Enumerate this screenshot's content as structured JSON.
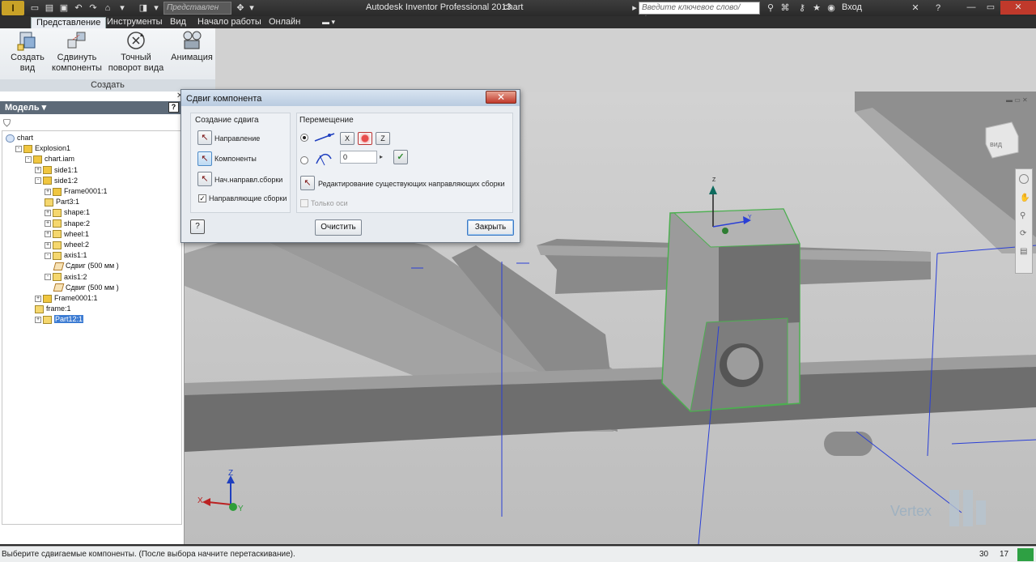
{
  "titlebar": {
    "qat_search": "Представлен",
    "app_title": "Autodesk Inventor Professional 2013",
    "doc_name": "chart",
    "help_search_placeholder": "Введите ключевое слово/фразу",
    "login": "Вход"
  },
  "ribbon": {
    "tabs": [
      "Представление",
      "Инструменты",
      "Вид",
      "Начало работы",
      "Онлайн"
    ],
    "active_tab": "Представление",
    "buttons": [
      {
        "label": "Создать вид",
        "icon": "create-view-icon"
      },
      {
        "label": "Сдвинуть компоненты",
        "icon": "tweak-components-icon"
      },
      {
        "label": "Точный поворот вида",
        "icon": "precise-rotate-icon"
      },
      {
        "label": "Анимация",
        "icon": "animation-icon"
      }
    ],
    "panel_label": "Создать"
  },
  "browser": {
    "title": "Модель ▾",
    "tree": [
      {
        "label": "chart",
        "depth": 0,
        "icon": "root"
      },
      {
        "label": "Explosion1",
        "depth": 1,
        "icon": "asm",
        "exp": "-"
      },
      {
        "label": "chart.iam",
        "depth": 2,
        "icon": "asm",
        "exp": "-"
      },
      {
        "label": "side1:1",
        "depth": 3,
        "icon": "asm",
        "exp": "+"
      },
      {
        "label": "side1:2",
        "depth": 3,
        "icon": "asm",
        "exp": "-"
      },
      {
        "label": "Frame0001:1",
        "depth": 4,
        "icon": "asm",
        "exp": "+"
      },
      {
        "label": "Part3:1",
        "depth": 4,
        "icon": "part"
      },
      {
        "label": "shape:1",
        "depth": 4,
        "icon": "part",
        "exp": "+"
      },
      {
        "label": "shape:2",
        "depth": 4,
        "icon": "part",
        "exp": "+"
      },
      {
        "label": "wheel:1",
        "depth": 4,
        "icon": "part",
        "exp": "+"
      },
      {
        "label": "wheel:2",
        "depth": 4,
        "icon": "part",
        "exp": "+"
      },
      {
        "label": "axis1:1",
        "depth": 4,
        "icon": "part",
        "exp": "-"
      },
      {
        "label": "Сдвиг (500 мм )",
        "depth": 5,
        "icon": "tw"
      },
      {
        "label": "axis1:2",
        "depth": 4,
        "icon": "part",
        "exp": "-"
      },
      {
        "label": "Сдвиг (500 мм )",
        "depth": 5,
        "icon": "tw"
      },
      {
        "label": "Frame0001:1",
        "depth": 3,
        "icon": "asm",
        "exp": "+"
      },
      {
        "label": "frame:1",
        "depth": 3,
        "icon": "part"
      },
      {
        "label": "Part12:1",
        "depth": 3,
        "icon": "part",
        "exp": "+",
        "selected": true
      }
    ]
  },
  "dialog": {
    "title": "Сдвиг компонента",
    "create_group": {
      "title": "Создание сдвига",
      "direction": "Направление",
      "components": "Компоненты",
      "trail_origin": "Нач.направл.сборки",
      "trails_checkbox": "Направляющие сборки",
      "trails_checked": true
    },
    "transform_group": {
      "title": "Перемещение",
      "axes": [
        "X",
        "Y",
        "Z"
      ],
      "active_axis": "Y",
      "angle_value": "0",
      "edit_trails": "Редактирование существующих направляющих сборки",
      "only_axes": "Только оси",
      "only_axes_checked": false
    },
    "clear_button": "Очистить",
    "close_button": "Закрыть"
  },
  "viewport": {
    "viewcube_face": "вид",
    "triad_labels": {
      "x": "X",
      "y": "Y",
      "z": "Z"
    },
    "watermark": "Vertex"
  },
  "status": {
    "message": "Выберите сдвигаемые компоненты. (После выбора начните перетаскивание).",
    "count1": "30",
    "count2": "17"
  },
  "colors": {
    "accent": "#3d7cd3",
    "selection_outline": "#4caf50",
    "status_indicator": "#2ea043"
  }
}
